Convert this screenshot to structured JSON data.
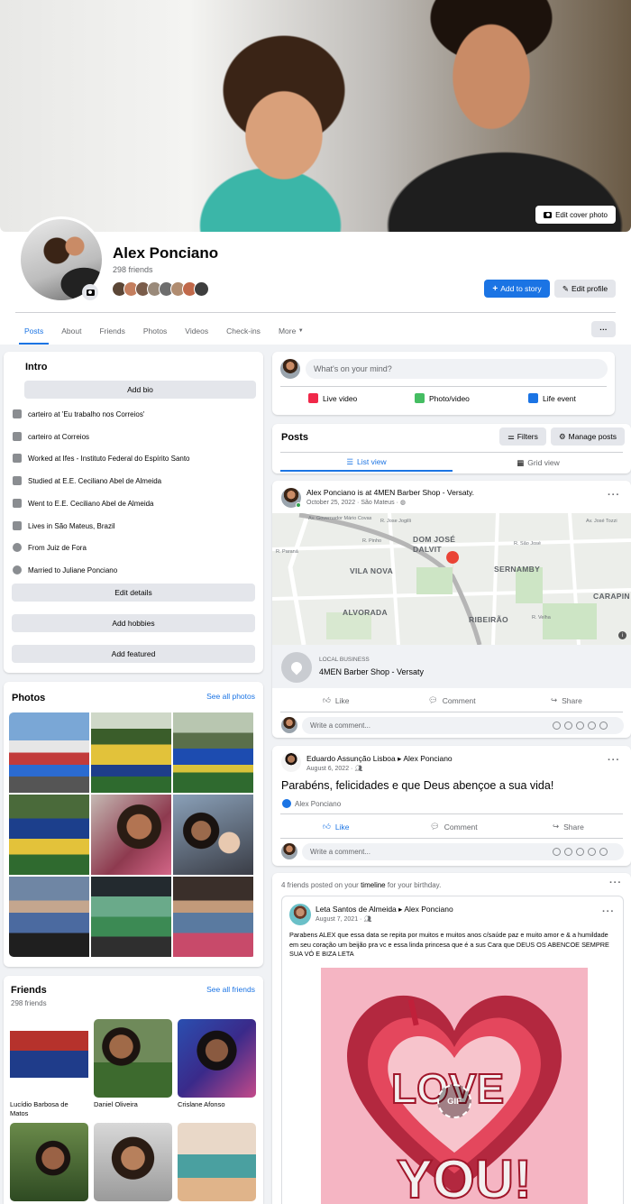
{
  "cover": {
    "edit_cover_label": "Edit cover photo"
  },
  "profile": {
    "name": "Alex Ponciano",
    "friends_count": "298 friends",
    "add_story_label": "Add to story",
    "edit_profile_label": "Edit profile"
  },
  "tabs": [
    "Posts",
    "About",
    "Friends",
    "Photos",
    "Videos",
    "Check-ins",
    "More"
  ],
  "intro": {
    "title": "Intro",
    "add_bio": "Add bio",
    "items": [
      {
        "icon": "briefcase-icon",
        "text": "carteiro at ",
        "bold": "'Eu trabalho nos Correios'"
      },
      {
        "icon": "briefcase-icon",
        "text": "carteiro at Correios",
        "bold": ""
      },
      {
        "icon": "briefcase-icon",
        "text": "Worked at ",
        "bold": "Ifes - Instituto Federal do Espírito Santo"
      },
      {
        "icon": "graduation-cap-icon",
        "text": "Studied at E.E. Ceciliano Abel de Almeida",
        "bold": ""
      },
      {
        "icon": "graduation-cap-icon",
        "text": "Went to E.E. Ceciliano Abel de Almeida",
        "bold": ""
      },
      {
        "icon": "home-icon",
        "text": "Lives in ",
        "bold": "São Mateus, Brazil"
      },
      {
        "icon": "location-pin-icon",
        "text": "From ",
        "bold": "Juiz de Fora"
      },
      {
        "icon": "heart-icon",
        "text": "Married to ",
        "bold": "Juliane Ponciano"
      }
    ],
    "edit_details": "Edit details",
    "add_hobbies": "Add hobbies",
    "add_featured": "Add featured"
  },
  "photos": {
    "title": "Photos",
    "see_all": "See all photos"
  },
  "friends": {
    "title": "Friends",
    "count": "298 friends",
    "see_all": "See all friends",
    "items": [
      {
        "name": "Lucídio Barbosa de Matos"
      },
      {
        "name": "Daniel Oliveira"
      },
      {
        "name": "Crislane Afonso"
      },
      {
        "name": ""
      },
      {
        "name": ""
      },
      {
        "name": ""
      }
    ]
  },
  "composer": {
    "placeholder": "What's on your mind?",
    "live_video": "Live video",
    "photo_video": "Photo/video",
    "life_event": "Life event"
  },
  "posts_header": {
    "title": "Posts",
    "filters": "Filters",
    "manage_posts": "Manage posts",
    "list_view": "List view",
    "grid_view": "Grid view"
  },
  "post1": {
    "author": "Alex Ponciano",
    "suffix": " is at 4MEN Barber Shop - Versaty.",
    "meta": "October 25, 2022 · São Mateus · ",
    "map_labels": [
      "DOM JOSÉ DALVIT",
      "VILA NOVA",
      "SERNAMBY",
      "ALVORADA",
      "RIBEIRÃO",
      "CARAPIN"
    ],
    "map_streets": [
      "R. Jose Jogilli",
      "Av. José Tozzi",
      "R. São José",
      "Av. Governador Mário Covas",
      "R. Paraná",
      "R. Velha",
      "R. Pinho"
    ],
    "local_business_label": "LOCAL BUSINESS",
    "place_name": "4MEN Barber Shop - Versaty",
    "like": "Like",
    "comment": "Comment",
    "share": "Share",
    "write_comment": "Write a comment..."
  },
  "post2": {
    "author": "Eduardo Assunção Lisboa",
    "arrow": " ▸ ",
    "target": "Alex Ponciano",
    "meta": "August 6, 2022 · ",
    "text": "Parabéns, felicidades e que Deus abençoe a sua vida!",
    "reaction_name": "Alex Ponciano",
    "like": "Like",
    "comment": "Comment",
    "share": "Share",
    "write_comment": "Write a comment..."
  },
  "post3": {
    "header_pre": "4 friends posted on your ",
    "header_bold": "timeline",
    "header_post": " for your birthday.",
    "author": "Leta Santos de Almeida",
    "arrow": " ▸ ",
    "target": "Alex Ponciano",
    "meta": "August 7, 2021 · ",
    "text": "Parabens ALEX que essa data se repita por muitos e muitos anos c/saúde paz e muito amor e & a humildade em seu coração um beijão pra vc e essa linda princesa que é a sus Cara que DEUS OS ABENCOE SEMPRE SUA VÓ E BIZA LETA",
    "gif_label": "GIF"
  },
  "colors": {
    "accent": "#1b74e4",
    "background": "#f0f2f5",
    "card": "#ffffff"
  }
}
